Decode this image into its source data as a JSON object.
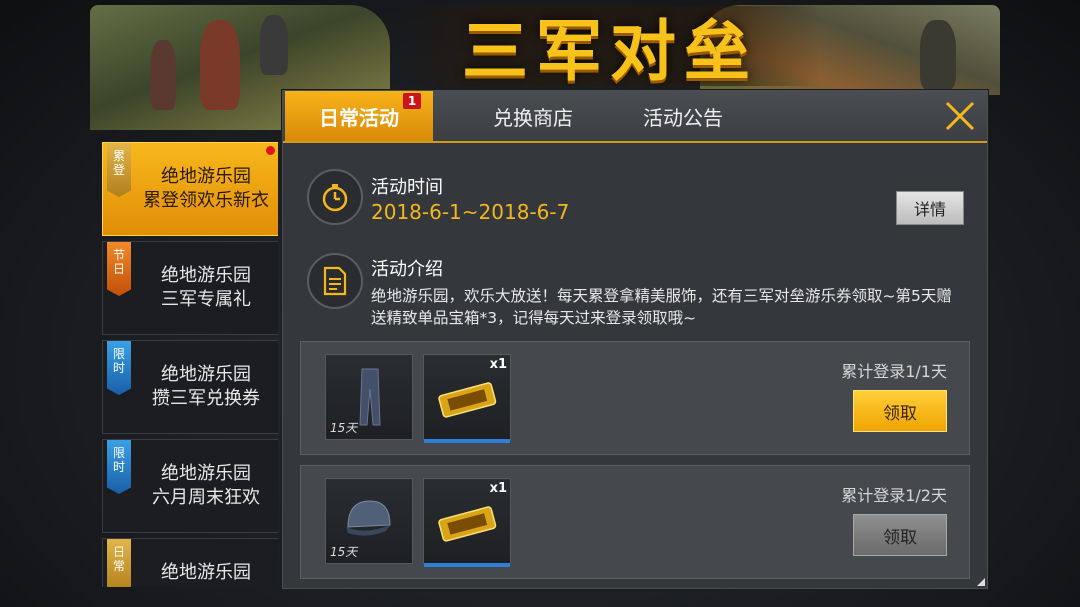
{
  "banner": {
    "title": "三军对垒"
  },
  "tabs": [
    {
      "label": "日常活动",
      "badge": "1",
      "active": true
    },
    {
      "label": "兑换商店"
    },
    {
      "label": "活动公告"
    }
  ],
  "sidebar": {
    "items": [
      {
        "tag": [
          "累",
          "登"
        ],
        "line1": "绝地游乐园",
        "line2": "累登领欢乐新衣",
        "active": true,
        "color": "gold"
      },
      {
        "tag": [
          "节",
          "日"
        ],
        "line1": "绝地游乐园",
        "line2": "三军专属礼",
        "color": "orange"
      },
      {
        "tag": [
          "限",
          "时"
        ],
        "line1": "绝地游乐园",
        "line2": "攒三军兑换券",
        "color": "blue"
      },
      {
        "tag": [
          "限",
          "时"
        ],
        "line1": "绝地游乐园",
        "line2": "六月周末狂欢",
        "color": "blue"
      },
      {
        "tag": [
          "日",
          "常"
        ],
        "line1": "绝地游乐园",
        "line2": "",
        "color": "gold"
      }
    ]
  },
  "activity": {
    "time_label": "活动时间",
    "time_range": "2018-6-1~2018-6-7",
    "detail_button": "详情",
    "intro_label": "活动介绍",
    "intro_text": "绝地游乐园，欢乐大放送！每天累登拿精美服饰，还有三军对垒游乐券领取~第5天赠送精致单品宝箱*3，记得每天过来登录领取哦~"
  },
  "rewards": [
    {
      "item1_days": "15天",
      "item2_qty": "x1",
      "progress": "累计登录1/1天",
      "button": "领取",
      "enabled": true
    },
    {
      "item1_days": "15天",
      "item2_qty": "x1",
      "progress": "累计登录1/2天",
      "button": "领取",
      "enabled": false
    }
  ],
  "colors": {
    "accent": "#f4b81c",
    "badge": "#c8161a",
    "panel": "#34373c"
  }
}
